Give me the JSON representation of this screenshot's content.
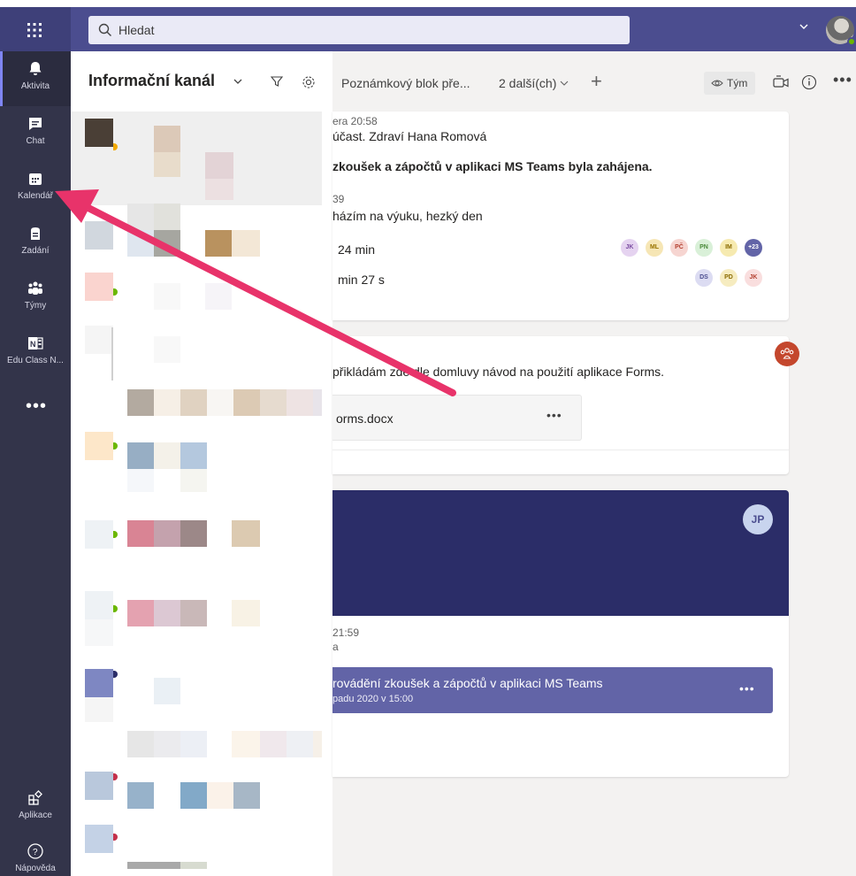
{
  "search": {
    "placeholder": "Hledat"
  },
  "rail": {
    "items": [
      {
        "label": "Aktivita",
        "icon": "bell-icon"
      },
      {
        "label": "Chat",
        "icon": "chat-icon"
      },
      {
        "label": "Kalendář",
        "icon": "calendar-icon"
      },
      {
        "label": "Zadání",
        "icon": "assignments-icon"
      },
      {
        "label": "Týmy",
        "icon": "teams-icon"
      },
      {
        "label": "Edu Class N...",
        "icon": "onenote-icon"
      }
    ],
    "more": "•••",
    "apps_label": "Aplikace",
    "help_label": "Nápověda"
  },
  "feed": {
    "title": "Informační kanál"
  },
  "main": {
    "tabs": {
      "notes": "Poznámkový blok pře...",
      "more": "2 další(ch)"
    },
    "team_button": "Tým",
    "post1": {
      "time": "era 20:58",
      "line1": "účast. Zdraví Hana Romová",
      "line2": "zkoušek a zápočtů v aplikaci MS Teams byla zahájena.",
      "time2": "39",
      "line3": "házím na výuku, hezký den",
      "meeting1": "24 min",
      "meeting2": "min 27 s",
      "participants1": [
        "JK",
        "ML",
        "PČ",
        "PN",
        "IM",
        "+23"
      ],
      "participants2": [
        "DS",
        "PD",
        "JK"
      ]
    },
    "post2": {
      "text": "přikládám zde dle domluvy návod na použití aplikace Forms.",
      "file": "orms.docx",
      "file_more": "•••"
    },
    "post3": {
      "avatar": "JP",
      "time": "21:59",
      "author_fragment": "a",
      "meeting_title": "rovádění zkoušek a zápočtů v aplikaci MS Teams",
      "meeting_date": "padu 2020 v 15:00",
      "meeting_more": "•••"
    }
  },
  "colors": {
    "topbar": "#4b4d8f",
    "rail": "#33344a",
    "accent": "#6264a7",
    "arrow": "#e8336a"
  }
}
